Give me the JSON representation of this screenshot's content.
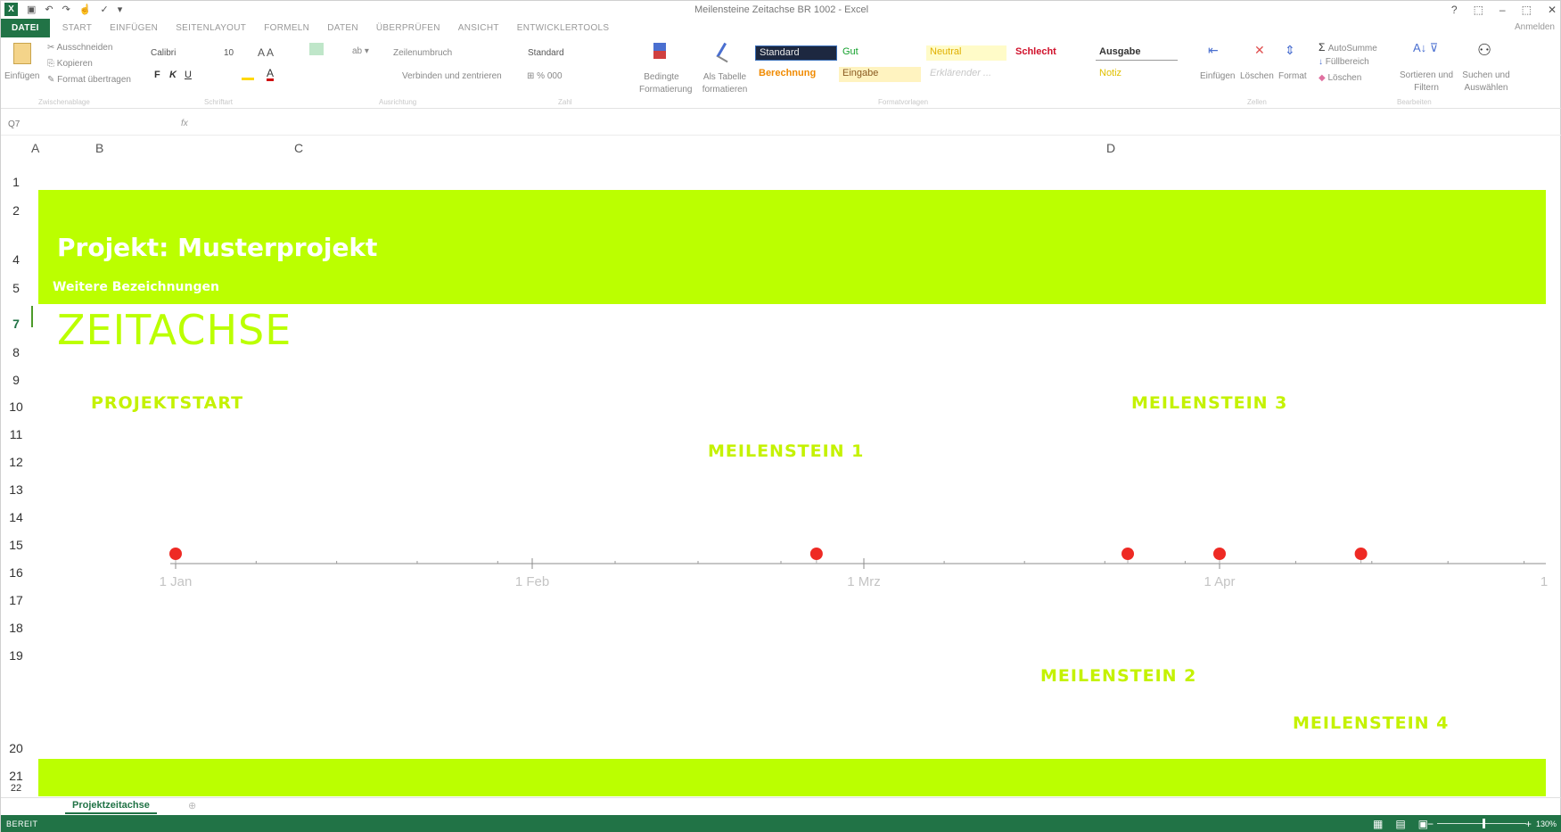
{
  "window": {
    "title": "Meilensteine Zeitachse BR 1002 - Excel",
    "controls": [
      "?",
      "⬚",
      "–",
      "⬚",
      "✕"
    ],
    "signin": "Anmelden"
  },
  "ribbon_tabs": [
    "DATEI",
    "START",
    "EINFÜGEN",
    "SEITENLAYOUT",
    "FORMELN",
    "DATEN",
    "ÜBERPRÜFEN",
    "ANSICHT",
    "ENTWICKLERTOOLS"
  ],
  "ribbon": {
    "paste": "Einfügen",
    "cut": "Ausschneiden",
    "copy": "Kopieren",
    "format_painter": "Format übertragen",
    "font_name": "Calibri",
    "font_size": "10",
    "bold": "F",
    "italic": "K",
    "underline": "U",
    "wrap_text": "Zeilenumbruch",
    "merge_center": "Verbinden und zentrieren",
    "number_format": "Standard",
    "cond_format": "Bedingte Formatierung",
    "as_table": "Als Tabelle formatieren",
    "styles": {
      "standard": "Standard",
      "gut": "Gut",
      "neutral": "Neutral",
      "schlecht": "Schlecht",
      "ausgabe": "Ausgabe",
      "berechnung": "Berechnung",
      "eingabe": "Eingabe",
      "erklaerend": "Erklärender ...",
      "notiz": "Notiz"
    },
    "cells_insert": "Einfügen",
    "cells_delete": "Löschen",
    "cells_format": "Format",
    "autosum": "AutoSumme",
    "fill": "Füllbereich",
    "clear": "Löschen",
    "sort_filter": "Sortieren und Filtern",
    "find_select": "Suchen und Auswählen",
    "groups": [
      "Zwischenablage",
      "Schriftart",
      "Ausrichtung",
      "Zahl",
      "Formatvorlagen",
      "Zellen",
      "Bearbeiten"
    ]
  },
  "formula_bar": {
    "name_box": "Q7",
    "fx": "fx",
    "value": ""
  },
  "columns": [
    "A",
    "B",
    "C",
    "D"
  ],
  "rows": [
    "1",
    "2",
    "4",
    "5",
    "7",
    "8",
    "9",
    "10",
    "11",
    "12",
    "13",
    "14",
    "15",
    "16",
    "17",
    "18",
    "19",
    "20",
    "21",
    "22"
  ],
  "sheet": {
    "project_title": "Projekt: Musterprojekt",
    "subtitle": "Weitere Bezeichnungen",
    "heading": "ZEITACHSE",
    "labels": {
      "start": "PROJEKTSTART",
      "m1": "MEILENSTEIN 1",
      "m2": "MEILENSTEIN 2",
      "m3": "MEILENSTEIN 3",
      "m4": "MEILENSTEIN 4"
    }
  },
  "timeline": {
    "axis_ticks": [
      "1 Jan",
      "1 Feb",
      "1 Mrz",
      "1 Apr"
    ],
    "axis_end_label": "1",
    "milestones": [
      {
        "name": "Projektstart",
        "date": "1 Jan"
      },
      {
        "name": "Meilenstein 1",
        "date": "25 Feb"
      },
      {
        "name": "Meilenstein 2",
        "date": "24 Mrz"
      },
      {
        "name": "Meilenstein 3",
        "date": "1 Apr"
      },
      {
        "name": "Meilenstein 4",
        "date": "14 Apr"
      }
    ],
    "marker_color": "#ee2a24",
    "accent_color": "#bbff00"
  },
  "sheet_tabs": [
    "Projektzeitachse"
  ],
  "status": {
    "ready": "BEREIT",
    "zoom": "130%"
  }
}
